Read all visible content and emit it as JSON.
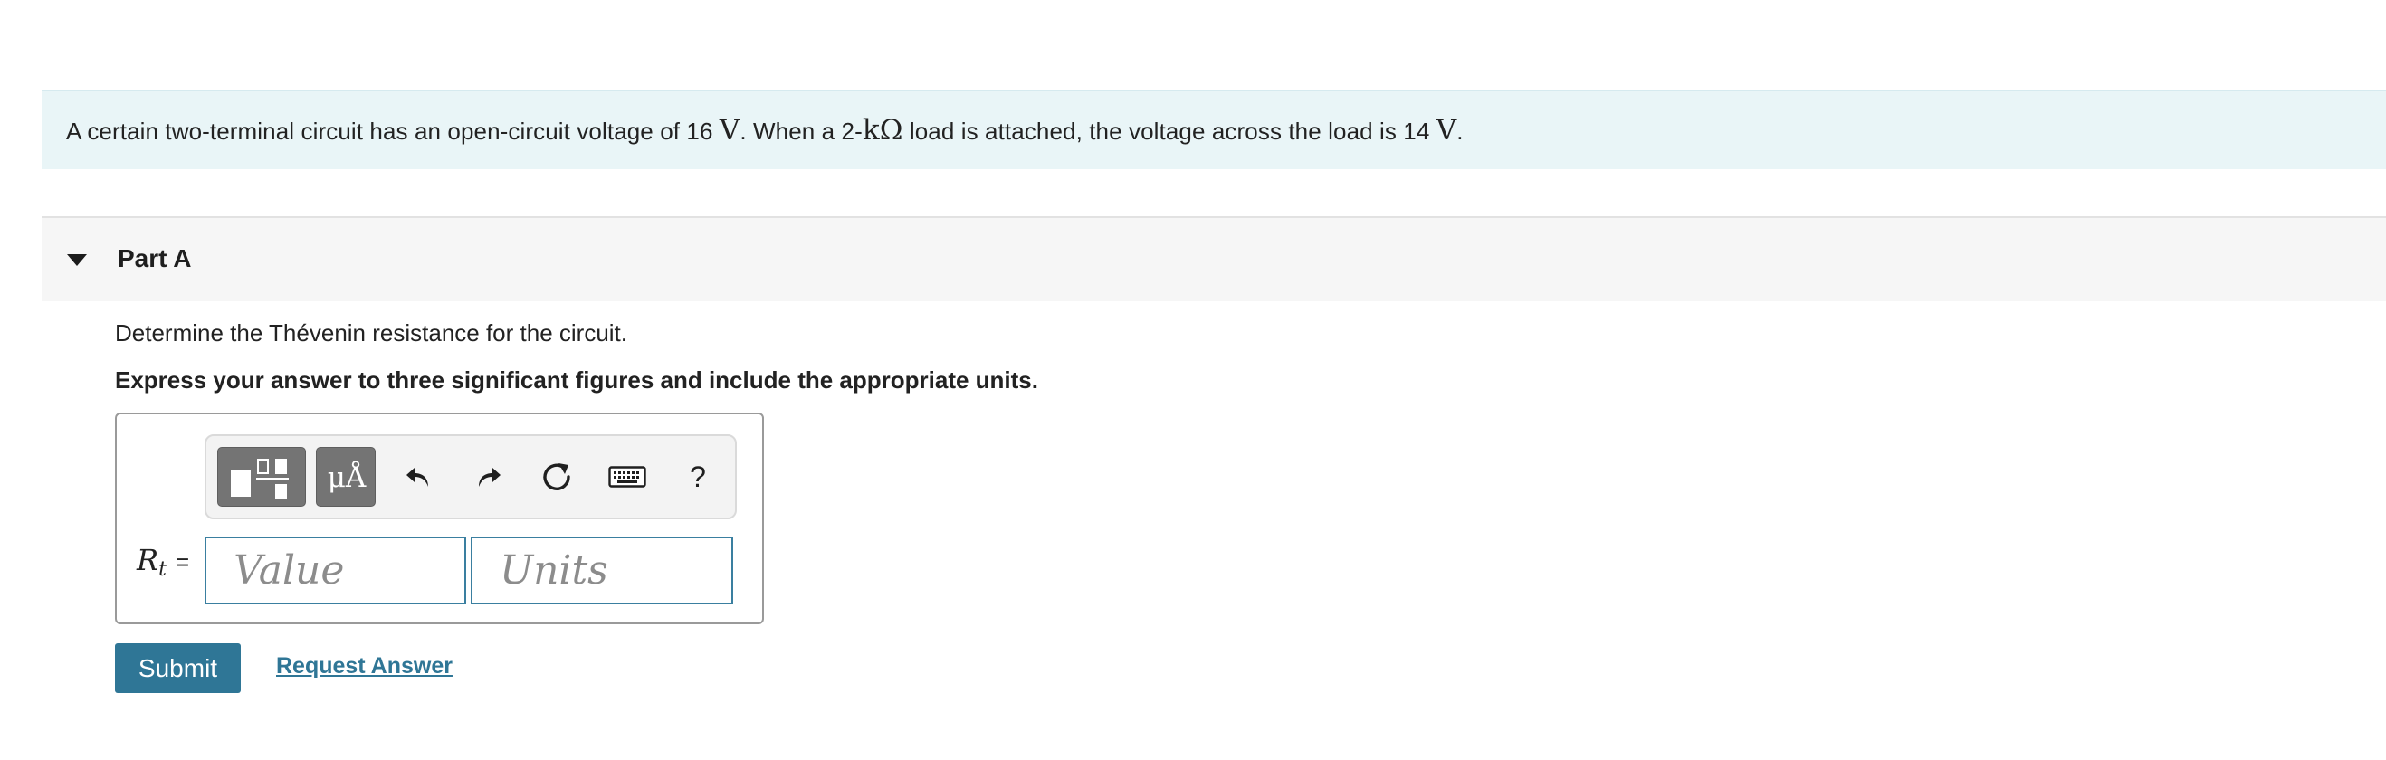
{
  "problem": {
    "text_1": "A certain two-terminal circuit has an open-circuit voltage of 16 ",
    "unit_v1": "V",
    "text_2": ". When a 2-",
    "unit_kohm": "kΩ",
    "text_3": " load is attached, the voltage across the load is 14 ",
    "unit_v2": "V",
    "text_4": "."
  },
  "part": {
    "title": "Part A",
    "question": "Determine the Thévenin resistance for the circuit.",
    "instruction": "Express your answer to three significant figures and include the appropriate units."
  },
  "answer": {
    "variable_symbol": "R",
    "variable_subscript": "t",
    "equals": "=",
    "value_placeholder": "Value",
    "units_placeholder": "Units",
    "value": "",
    "units": ""
  },
  "toolbar": {
    "template_icon": "templates-icon",
    "units_glyph": "μÅ",
    "undo_icon": "undo-icon",
    "redo_icon": "redo-icon",
    "reset_icon": "reset-icon",
    "keyboard_icon": "keyboard-icon",
    "help_label": "?"
  },
  "actions": {
    "submit_label": "Submit",
    "request_answer_label": "Request Answer"
  },
  "colors": {
    "banner_bg": "#e9f5f7",
    "accent": "#2f7696",
    "part_header_bg": "#f6f6f6",
    "tool_button_bg": "#747474"
  }
}
